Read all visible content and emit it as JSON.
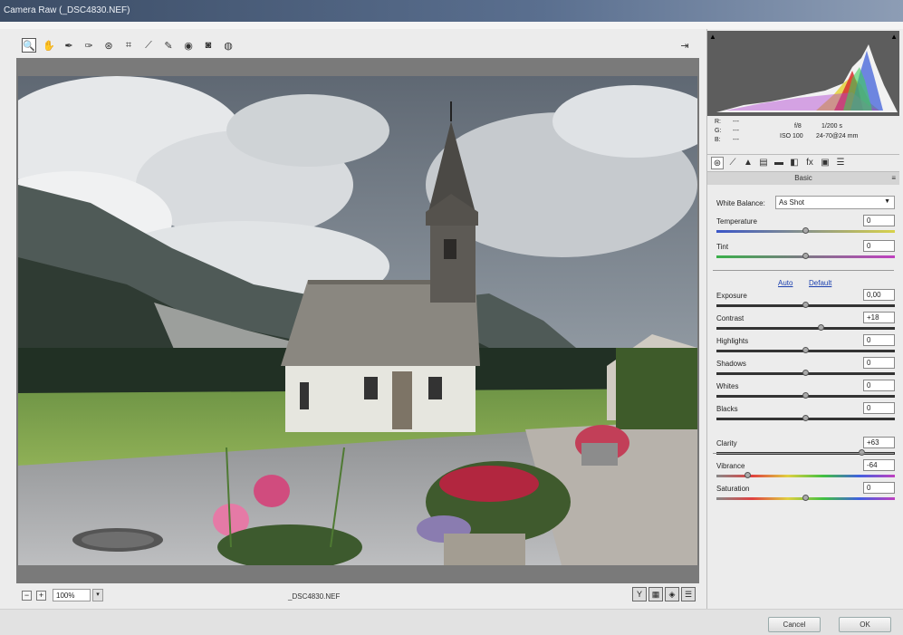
{
  "window": {
    "title": "Camera Raw (_DSC4830.NEF)"
  },
  "toolbar": {
    "tools": [
      {
        "name": "zoom-tool-icon",
        "glyph": "🔍"
      },
      {
        "name": "hand-tool-icon",
        "glyph": "✋"
      },
      {
        "name": "white-balance-tool-icon",
        "glyph": "✒"
      },
      {
        "name": "color-sampler-tool-icon",
        "glyph": "✑"
      },
      {
        "name": "targeted-adjustment-tool-icon",
        "glyph": "⊛"
      },
      {
        "name": "crop-tool-icon",
        "glyph": "⌗"
      },
      {
        "name": "straighten-tool-icon",
        "glyph": "⟋"
      },
      {
        "name": "spot-removal-tool-icon",
        "glyph": "✎"
      },
      {
        "name": "red-eye-tool-icon",
        "glyph": "◉"
      },
      {
        "name": "adjustment-brush-icon",
        "glyph": "◙"
      },
      {
        "name": "graduated-filter-icon",
        "glyph": "◍"
      }
    ],
    "exit_glyph": "⇥"
  },
  "status": {
    "zoom": "100%",
    "filename": "_DSC4830.NEF",
    "zoom_out": "−",
    "zoom_in": "+",
    "dropdown": "▾",
    "view_buttons": [
      "Y",
      "▦",
      "◈",
      "☰"
    ]
  },
  "rgb": {
    "r_label": "R:",
    "g_label": "G:",
    "b_label": "B:",
    "dash": "---"
  },
  "camera": {
    "aperture": "f/8",
    "shutter": "1/200 s",
    "iso": "ISO 100",
    "lens": "24-70@24 mm"
  },
  "panel": {
    "title": "Basic",
    "menu_glyph": "≡"
  },
  "tabs": [
    "⊛",
    "⟋",
    "▲",
    "▤",
    "▬",
    "◧",
    "fx",
    "▣",
    "☰"
  ],
  "white_balance": {
    "label": "White Balance:",
    "value": "As Shot"
  },
  "links": {
    "auto": "Auto",
    "default": "Default"
  },
  "sliders": [
    {
      "key": "temperature",
      "label": "Temperature",
      "value": "0",
      "level": 0.5
    },
    {
      "key": "tint",
      "label": "Tint",
      "value": "0",
      "level": 0.5
    },
    {
      "key": "exposure",
      "label": "Exposure",
      "value": "0,00",
      "level": 0.5
    },
    {
      "key": "contrast",
      "label": "Contrast",
      "value": "+18",
      "level": 0.59
    },
    {
      "key": "highlights",
      "label": "Highlights",
      "value": "0",
      "level": 0.5
    },
    {
      "key": "shadows",
      "label": "Shadows",
      "value": "0",
      "level": 0.5
    },
    {
      "key": "whites",
      "label": "Whites",
      "value": "0",
      "level": 0.5
    },
    {
      "key": "blacks",
      "label": "Blacks",
      "value": "0",
      "level": 0.5
    },
    {
      "key": "clarity",
      "label": "Clarity",
      "value": "+63",
      "level": 0.815
    },
    {
      "key": "vibrance",
      "label": "Vibrance",
      "value": "-64",
      "level": 0.18
    },
    {
      "key": "saturation",
      "label": "Saturation",
      "value": "0",
      "level": 0.5
    }
  ],
  "buttons": {
    "cancel": "Cancel",
    "ok": "OK"
  }
}
